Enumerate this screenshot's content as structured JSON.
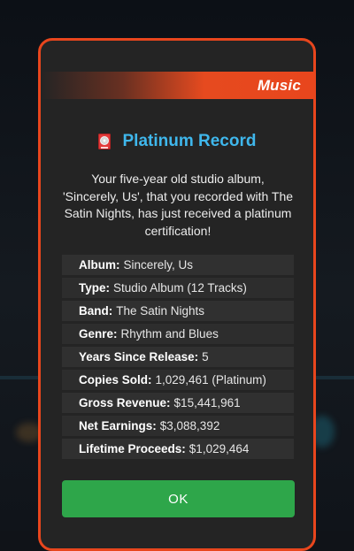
{
  "category": "Music",
  "title": "Platinum Record",
  "icon": "record-award-icon",
  "description": "Your five-year old studio album, 'Sincerely, Us', that you recorded with The Satin Nights, has just received a platinum certification!",
  "details": [
    {
      "label": "Album:",
      "value": "Sincerely, Us"
    },
    {
      "label": "Type:",
      "value": "Studio Album (12 Tracks)"
    },
    {
      "label": "Band:",
      "value": "The Satin Nights"
    },
    {
      "label": "Genre:",
      "value": "Rhythm and Blues"
    },
    {
      "label": "Years Since Release:",
      "value": "5"
    },
    {
      "label": "Copies Sold:",
      "value": "1,029,461 (Platinum)"
    },
    {
      "label": "Gross Revenue:",
      "value": "$15,441,961"
    },
    {
      "label": "Net Earnings:",
      "value": "$3,088,392"
    },
    {
      "label": "Lifetime Proceeds:",
      "value": "$1,029,464"
    }
  ],
  "ok_label": "OK",
  "colors": {
    "accent": "#e8461d",
    "title": "#3fb7ec",
    "button": "#2ea64a",
    "card": "#242424"
  }
}
